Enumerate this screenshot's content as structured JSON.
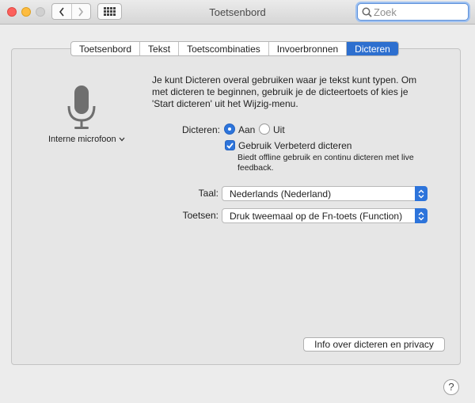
{
  "window": {
    "title": "Toetsenbord"
  },
  "search": {
    "placeholder": "Zoek"
  },
  "tabs": [
    {
      "label": "Toetsenbord"
    },
    {
      "label": "Tekst"
    },
    {
      "label": "Toetscombinaties"
    },
    {
      "label": "Invoerbronnen"
    },
    {
      "label": "Dicteren",
      "active": true
    }
  ],
  "microphone": {
    "label": "Interne microfoon"
  },
  "description": "Je kunt Dicteren overal gebruiken waar je tekst kunt typen. Om met dicteren te beginnen, gebruik je de dicteertoets of kies je 'Start dicteren' uit het Wijzig-menu.",
  "dictation": {
    "label": "Dicteren:",
    "on_label": "Aan",
    "off_label": "Uit",
    "selected": "Aan"
  },
  "enhanced": {
    "label": "Gebruik Verbeterd dicteren",
    "checked": true,
    "description": "Biedt offline gebruik en continu dicteren met live feedback."
  },
  "language": {
    "label": "Taal:",
    "value": "Nederlands (Nederland)"
  },
  "shortcut": {
    "label": "Toetsen:",
    "value": "Druk tweemaal op de Fn-toets (Function)"
  },
  "privacy_button": "Info over dicteren en privacy",
  "help_button": "?",
  "colors": {
    "accent": "#2d74db",
    "close": "#fc605c",
    "minimize": "#fdbc40"
  }
}
